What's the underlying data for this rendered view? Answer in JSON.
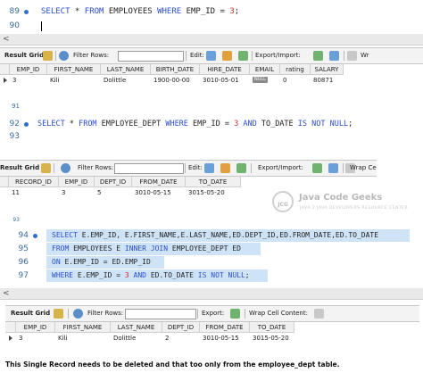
{
  "editor1": {
    "lines": [
      {
        "num": "89",
        "text": "SELECT * FROM EMPLOYEES WHERE EMP_ID = 3;"
      },
      {
        "num": "90",
        "text": ""
      }
    ]
  },
  "grid1": {
    "toolbar": {
      "result_grid": "Result Grid",
      "filter_rows": "Filter Rows:",
      "edit": "Edit:",
      "export_import": "Export/Import:",
      "wrap": "Wr"
    },
    "columns": [
      "EMP_ID",
      "FIRST_NAME",
      "LAST_NAME",
      "BIRTH_DATE",
      "HIRE_DATE",
      "EMAIL",
      "rating",
      "SALARY"
    ],
    "rows": [
      [
        "3",
        "Kili",
        "Dolittle",
        "1900-00-00",
        "3010-05-01",
        "NULL",
        "0",
        "80871"
      ]
    ]
  },
  "editor2": {
    "lines": [
      {
        "num": "91",
        "text": ""
      },
      {
        "num": "92",
        "text": "SELECT * FROM EMPLOYEE_DEPT WHERE EMP_ID = 3 AND TO_DATE IS NOT NULL;"
      },
      {
        "num": "93",
        "text": ""
      }
    ]
  },
  "grid2": {
    "toolbar": {
      "result_grid": "Result Grid",
      "filter_rows": "Filter Rows:",
      "edit": "Edit:",
      "export_import": "Export/Import:",
      "wrap": "Wrap Ce"
    },
    "columns": [
      "RECORD_ID",
      "EMP_ID",
      "DEPT_ID",
      "FROM_DATE",
      "TO_DATE"
    ],
    "rows": [
      [
        "11",
        "3",
        "5",
        "3010-05-15",
        "3015-05-20"
      ]
    ]
  },
  "watermark": {
    "title": "Java Code Geeks",
    "subtitle": "JAVA 2 JAVA DEVELOPERS RESOURCE CENTER",
    "logo_text": "JCG"
  },
  "editor3": {
    "lines": [
      {
        "num": "93",
        "text": ""
      },
      {
        "num": "94",
        "text": "SELECT E.EMP_ID, E.FIRST_NAME,E.LAST_NAME,ED.DEPT_ID,ED.FROM_DATE,ED.TO_DATE"
      },
      {
        "num": "95",
        "text": "FROM EMPLOYEES E INNER JOIN EMPLOYEE_DEPT ED"
      },
      {
        "num": "96",
        "text": "ON E.EMP_ID = ED.EMP_ID"
      },
      {
        "num": "97",
        "text": "WHERE E.EMP_ID = 3 AND ED.TO_DATE IS NOT NULL;"
      }
    ]
  },
  "grid3": {
    "toolbar": {
      "result_grid": "Result Grid",
      "filter_rows": "Filter Rows:",
      "export": "Export:",
      "wrap": "Wrap Cell Content:"
    },
    "columns": [
      "EMP_ID",
      "FIRST_NAME",
      "LAST_NAME",
      "DEPT_ID",
      "FROM_DATE",
      "TO_DATE"
    ],
    "rows": [
      [
        "3",
        "Kili",
        "Dolittle",
        "2",
        "3010-05-15",
        "3015-05-20"
      ]
    ]
  },
  "caption": "This Single Record needs to be deleted and that too only from the employee_dept table.",
  "colors": {
    "keyword": "#2a4dcc",
    "number": "#cc2a2a",
    "selection": "#cfe3f7",
    "line_marker": "#2f6fd0"
  }
}
